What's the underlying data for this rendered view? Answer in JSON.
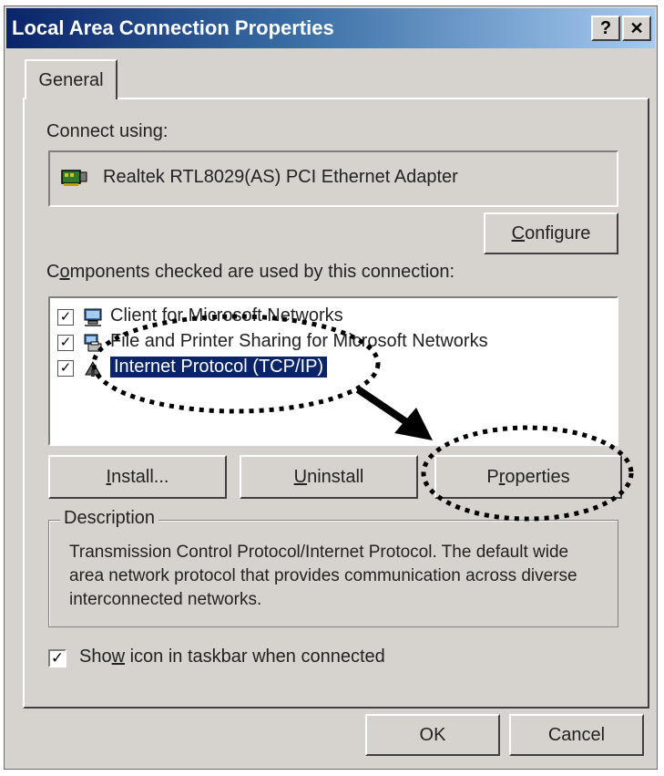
{
  "window": {
    "title": "Local Area Connection Properties",
    "help_label": "?",
    "close_label": "✕"
  },
  "tabs": [
    {
      "label": "General"
    }
  ],
  "connect_using": {
    "label": "Connect using:",
    "adapter": "Realtek RTL8029(AS) PCI Ethernet Adapter",
    "adapter_icon": "network-adapter-icon"
  },
  "buttons": {
    "configure_pre": "",
    "configure_u": "C",
    "configure_post": "onfigure",
    "install_u": "I",
    "install_post": "nstall...",
    "uninstall_u": "U",
    "uninstall_post": "ninstall",
    "properties_pre": "P",
    "properties_u": "r",
    "properties_post": "operties",
    "ok": "OK",
    "cancel": "Cancel"
  },
  "components": {
    "label_u": "o",
    "label_pre": "C",
    "label_post": "mponents checked are used by this connection:",
    "items": [
      {
        "label": "Client for Microsoft Networks",
        "checked": true,
        "icon": "client-network-icon",
        "selected": false
      },
      {
        "label": "File and Printer Sharing for Microsoft Networks",
        "checked": true,
        "icon": "file-printer-sharing-icon",
        "selected": false
      },
      {
        "label": "Internet Protocol (TCP/IP)",
        "checked": true,
        "icon": "protocol-icon",
        "selected": true
      }
    ]
  },
  "description": {
    "legend": "Description",
    "text": "Transmission Control Protocol/Internet Protocol. The default wide area network protocol that provides communication across diverse interconnected networks."
  },
  "taskbar_checkbox": {
    "pre": "Sho",
    "u": "w",
    "post": " icon in taskbar when connected",
    "checked": true
  },
  "colors": {
    "titlebar_start": "#0a246a",
    "titlebar_end": "#a6caf0",
    "face": "#d6d3ce",
    "selection": "#0a246a"
  }
}
